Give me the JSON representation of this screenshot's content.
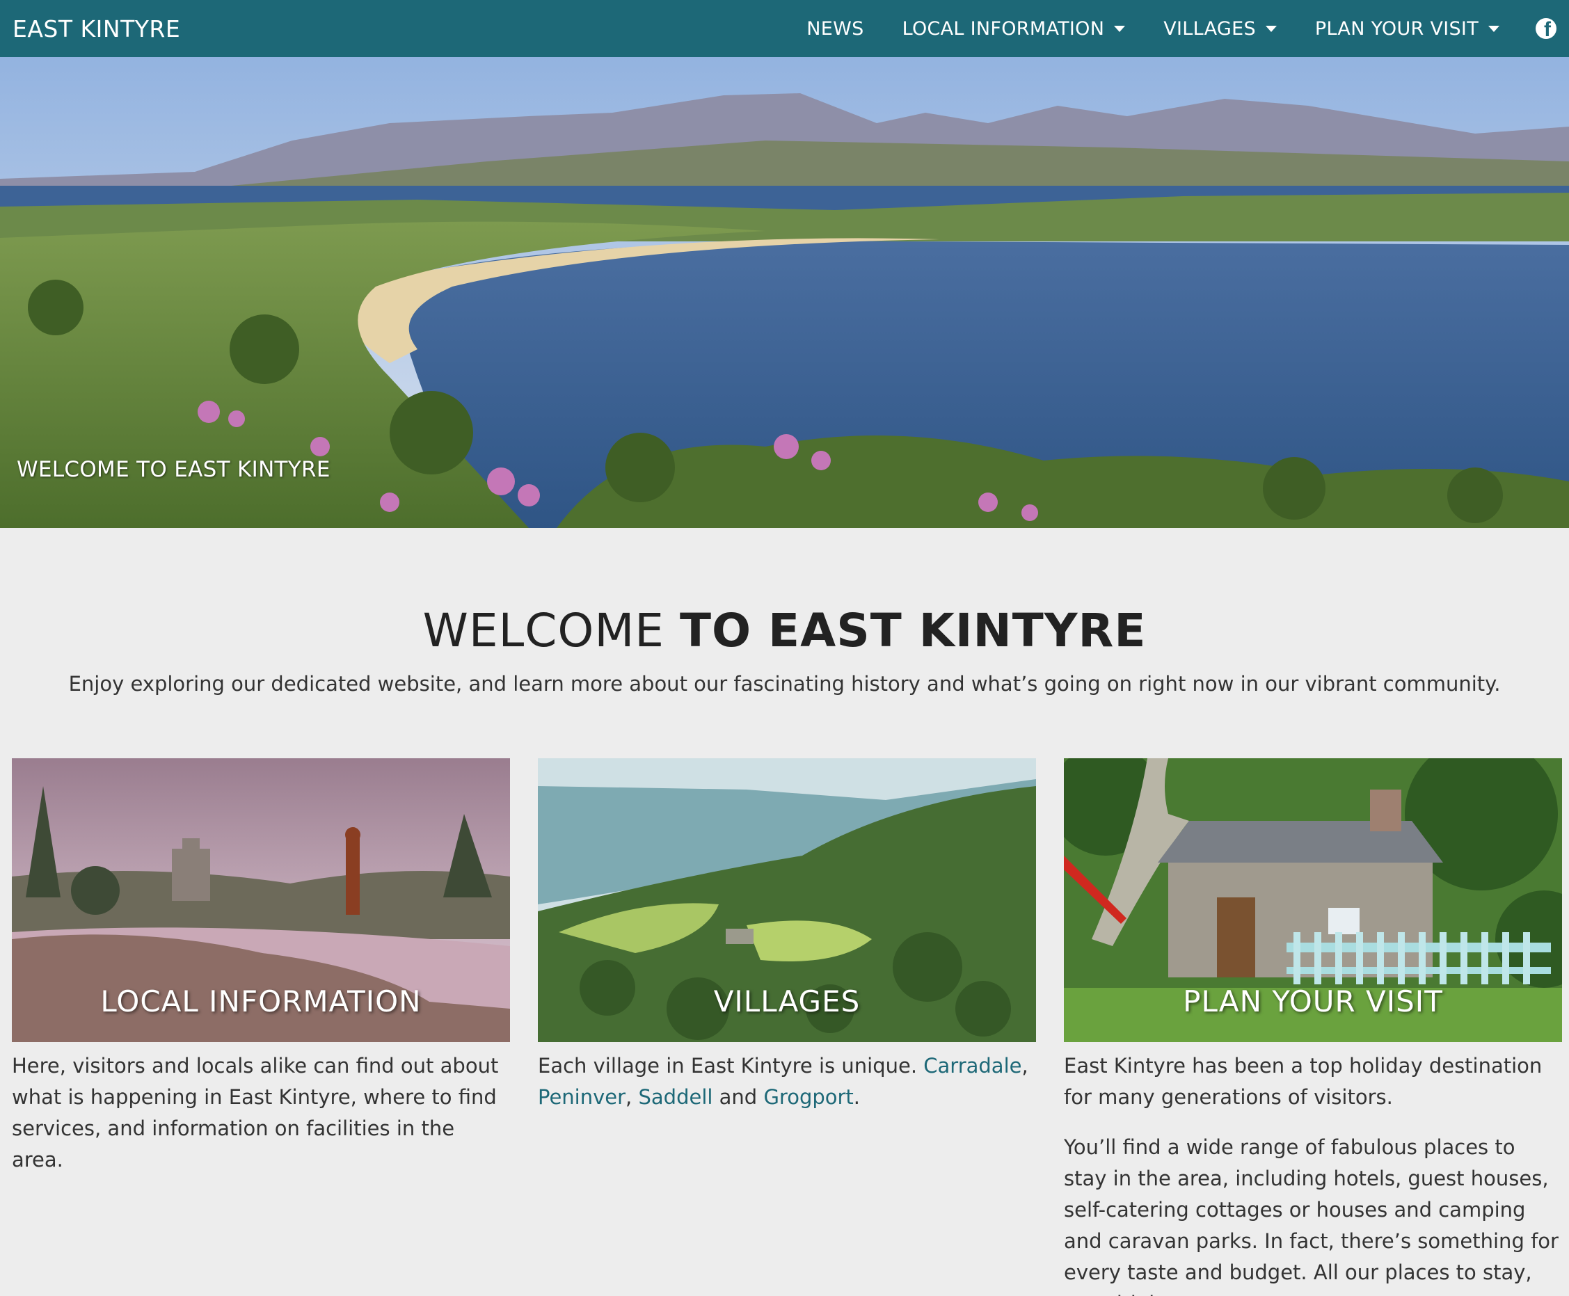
{
  "nav": {
    "brand": "EAST KINTYRE",
    "items": [
      {
        "label": "NEWS",
        "dropdown": false
      },
      {
        "label": "LOCAL INFORMATION",
        "dropdown": true
      },
      {
        "label": "VILLAGES",
        "dropdown": true
      },
      {
        "label": "PLAN YOUR VISIT",
        "dropdown": true
      }
    ],
    "social_icon": "facebook-icon"
  },
  "colors": {
    "nav_bg": "#1d6877",
    "page_bg": "#ededed",
    "link": "#1d6877"
  },
  "hero": {
    "caption": "WELCOME TO EAST KINTYRE"
  },
  "welcome": {
    "title_light": "WELCOME ",
    "title_bold": "TO EAST KINTYRE",
    "subtitle": "Enjoy exploring our dedicated website, and learn more about our fascinating history and what’s going on right now in our vibrant community."
  },
  "cards": {
    "local": {
      "label": "LOCAL INFORMATION",
      "text": "Here, visitors and locals alike can find out about what is happening in East Kintyre, where to find services, and information on facilities in the area."
    },
    "villages": {
      "label": "VILLAGES",
      "text_before": "Each village in East Kintyre is unique. ",
      "links": [
        "Carradale",
        "Peninver",
        "Saddell",
        "Grogport"
      ],
      "sep1": ", ",
      "sep2": ", ",
      "sep3": " and ",
      "end": "."
    },
    "visit": {
      "label": "PLAN YOUR VISIT",
      "text1": "East Kintyre has been a top holiday destination for many generations of visitors.",
      "text2": "You’ll find a wide range of fabulous places to stay in the area, including hotels, guest houses, self-catering cottages or houses and camping and caravan parks. In fact, there’s something for every taste and budget. All our places to stay, eat, drink,"
    }
  }
}
